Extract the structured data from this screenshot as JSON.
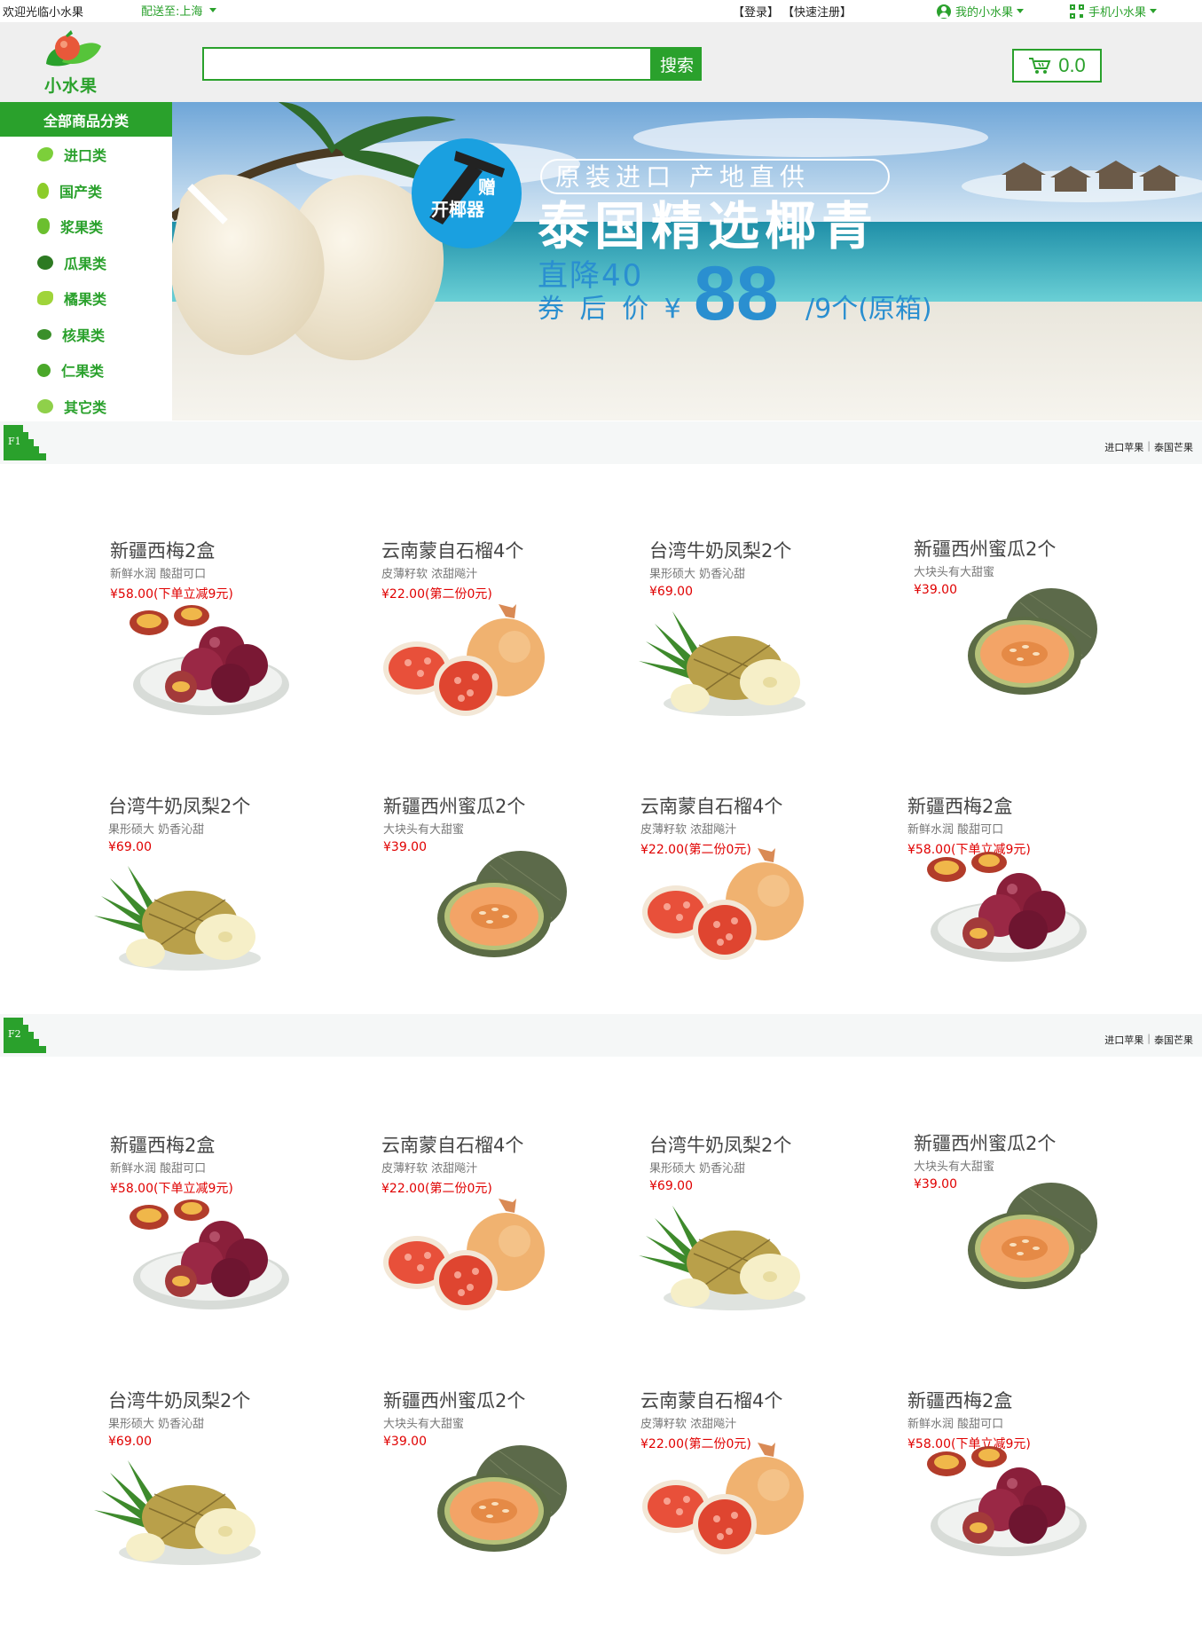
{
  "topbar": {
    "welcome": "欢迎光临小水果",
    "deliver_to": "配送至:上海",
    "login": "【登录】",
    "register": "【快速注册】",
    "my_account": "我的小水果",
    "mobile": "手机小水果"
  },
  "header": {
    "logo_text": "小水果",
    "search_placeholder": "",
    "search_button": "搜索",
    "cart_amount": "0.0"
  },
  "side_menu": {
    "title": "全部商品分类",
    "items": [
      {
        "label": "进口类"
      },
      {
        "label": "国产类"
      },
      {
        "label": "浆果类"
      },
      {
        "label": "瓜果类"
      },
      {
        "label": "橘果类"
      },
      {
        "label": "核果类"
      },
      {
        "label": "仁果类"
      },
      {
        "label": "其它类"
      }
    ]
  },
  "banner": {
    "gift_1": "赠",
    "gift_2": "开椰器",
    "tagline": "原装进口 产地直供",
    "headline": "泰国精选椰青",
    "discount": "直降40",
    "coupon_label": "券 后 价 ¥",
    "price": "88",
    "unit": "/9个(原箱)"
  },
  "floors": [
    {
      "tag": "F1",
      "links": [
        "进口苹果",
        "泰国芒果"
      ],
      "products": [
        {
          "name": "新疆西梅2盒",
          "desc": "新鲜水润 酸甜可口",
          "price": "¥58.00(下单立减9元)",
          "kind": "plum"
        },
        {
          "name": "云南蒙自石榴4个",
          "desc": "皮薄籽软 浓甜飚汁",
          "price": "¥22.00(第二份0元)",
          "kind": "pomegranate"
        },
        {
          "name": "台湾牛奶凤梨2个",
          "desc": "果形硕大 奶香沁甜",
          "price": "¥69.00",
          "kind": "pineapple"
        },
        {
          "name": "新疆西州蜜瓜2个",
          "desc": "大块头有大甜蜜",
          "price": "¥39.00",
          "kind": "melon"
        },
        {
          "name": "台湾牛奶凤梨2个",
          "desc": "果形硕大 奶香沁甜",
          "price": "¥69.00",
          "kind": "pineapple"
        },
        {
          "name": "新疆西州蜜瓜2个",
          "desc": "大块头有大甜蜜",
          "price": "¥39.00",
          "kind": "melon"
        },
        {
          "name": "云南蒙自石榴4个",
          "desc": "皮薄籽软 浓甜飚汁",
          "price": "¥22.00(第二份0元)",
          "kind": "pomegranate"
        },
        {
          "name": "新疆西梅2盒",
          "desc": "新鲜水润 酸甜可口",
          "price": "¥58.00(下单立减9元)",
          "kind": "plum"
        }
      ]
    },
    {
      "tag": "F2",
      "links": [
        "进口苹果",
        "泰国芒果"
      ],
      "products": [
        {
          "name": "新疆西梅2盒",
          "desc": "新鲜水润 酸甜可口",
          "price": "¥58.00(下单立减9元)",
          "kind": "plum"
        },
        {
          "name": "云南蒙自石榴4个",
          "desc": "皮薄籽软 浓甜飚汁",
          "price": "¥22.00(第二份0元)",
          "kind": "pomegranate"
        },
        {
          "name": "台湾牛奶凤梨2个",
          "desc": "果形硕大 奶香沁甜",
          "price": "¥69.00",
          "kind": "pineapple"
        },
        {
          "name": "新疆西州蜜瓜2个",
          "desc": "大块头有大甜蜜",
          "price": "¥39.00",
          "kind": "melon"
        },
        {
          "name": "台湾牛奶凤梨2个",
          "desc": "果形硕大 奶香沁甜",
          "price": "¥69.00",
          "kind": "pineapple"
        },
        {
          "name": "新疆西州蜜瓜2个",
          "desc": "大块头有大甜蜜",
          "price": "¥39.00",
          "kind": "melon"
        },
        {
          "name": "云南蒙自石榴4个",
          "desc": "皮薄籽软 浓甜飚汁",
          "price": "¥22.00(第二份0元)",
          "kind": "pomegranate"
        },
        {
          "name": "新疆西梅2盒",
          "desc": "新鲜水润 酸甜可口",
          "price": "¥58.00(下单立减9元)",
          "kind": "plum"
        }
      ]
    }
  ],
  "colors": {
    "brand_green": "#2aa12c",
    "price_red": "#e00000",
    "banner_blue": "#2a8fd0"
  }
}
